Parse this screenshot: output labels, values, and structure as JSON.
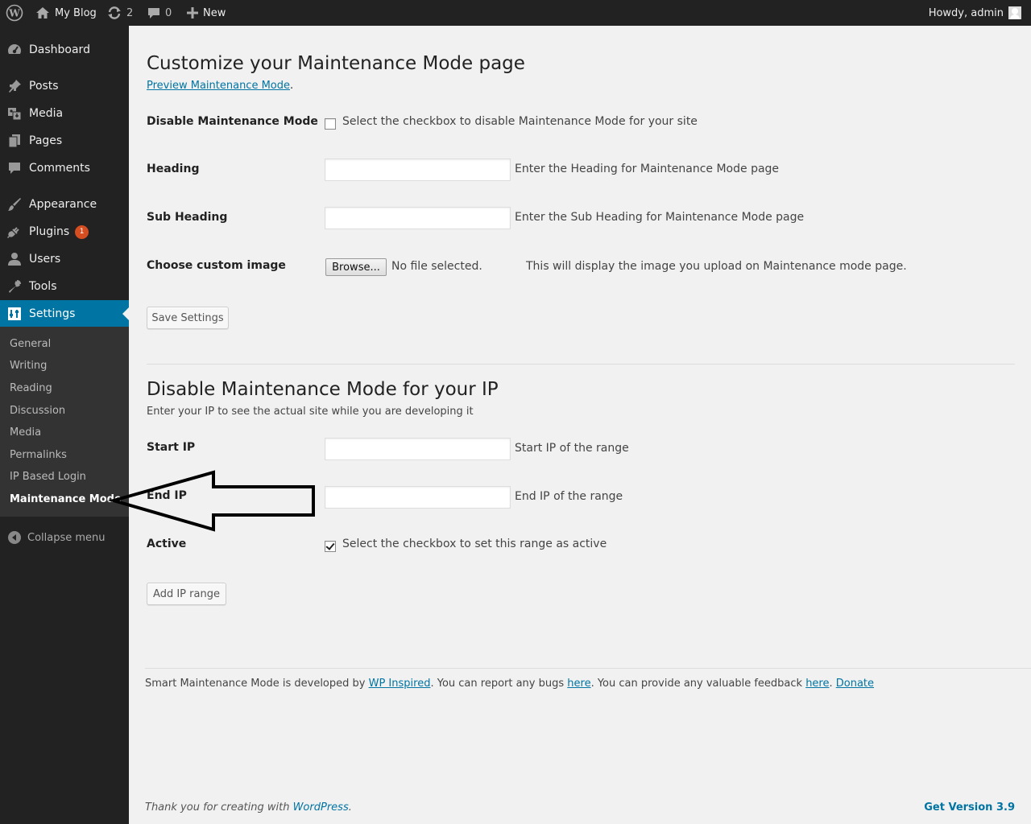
{
  "adminbar": {
    "site_name": "My Blog",
    "updates_count": "2",
    "comments_count": "0",
    "new_label": "New",
    "account_text": "Howdy, admin"
  },
  "menu": {
    "items": [
      {
        "label": "Dashboard",
        "icon": "dashboard-icon"
      },
      {
        "label": "Posts",
        "icon": "pin-icon"
      },
      {
        "label": "Media",
        "icon": "media-icon"
      },
      {
        "label": "Pages",
        "icon": "pages-icon"
      },
      {
        "label": "Comments",
        "icon": "comment-icon"
      },
      {
        "label": "Appearance",
        "icon": "brush-icon"
      },
      {
        "label": "Plugins",
        "icon": "plug-icon",
        "badge": "1"
      },
      {
        "label": "Users",
        "icon": "user-icon"
      },
      {
        "label": "Tools",
        "icon": "wrench-icon"
      },
      {
        "label": "Settings",
        "icon": "settings-icon"
      }
    ],
    "submenu": [
      "General",
      "Writing",
      "Reading",
      "Discussion",
      "Media",
      "Permalinks",
      "IP Based Login",
      "Maintenance Mode"
    ],
    "collapse_label": "Collapse menu"
  },
  "main": {
    "title": "Customize your Maintenance Mode page",
    "preview_link": "Preview Maintenance Mode",
    "preview_suffix": ".",
    "disable": {
      "label": "Disable Maintenance Mode",
      "desc": "Select the checkbox to disable Maintenance Mode for your site",
      "checked": false
    },
    "heading": {
      "label": "Heading",
      "value": "",
      "desc": "Enter the Heading for Maintenance Mode page"
    },
    "subheading": {
      "label": "Sub Heading",
      "value": "",
      "desc": "Enter the Sub Heading for Maintenance Mode page"
    },
    "image": {
      "label": "Choose custom image",
      "browse": "Browse...",
      "status": "No file selected.",
      "desc": "This will display the image you upload on Maintenance mode page."
    },
    "save_button": "Save Settings"
  },
  "ip_section": {
    "title": "Disable Maintenance Mode for your IP",
    "subtitle": "Enter your IP to see the actual site while you are developing it",
    "start": {
      "label": "Start IP",
      "value": "",
      "desc": "Start IP of the range"
    },
    "end": {
      "label": "End IP",
      "value": "",
      "desc": "End IP of the range"
    },
    "active": {
      "label": "Active",
      "desc": "Select the checkbox to set this range as active",
      "checked": true
    },
    "add_button": "Add IP range"
  },
  "plugin_footer": {
    "text1": "Smart Maintenance Mode is developed by ",
    "link1": "WP Inspired",
    "text2": ". You can report any bugs ",
    "link2": "here",
    "text3": ". You can provide any valuable feedback ",
    "link3": "here",
    "text4": ". ",
    "link4": "Donate"
  },
  "wp_footer": {
    "thanks_prefix": "Thank you for creating with ",
    "thanks_link": "WordPress",
    "thanks_suffix": ".",
    "version": "Get Version 3.9"
  },
  "colors": {
    "menu_bg": "#222222",
    "accent": "#0074a2",
    "badge": "#d54e21",
    "page_bg": "#f1f1f1"
  }
}
